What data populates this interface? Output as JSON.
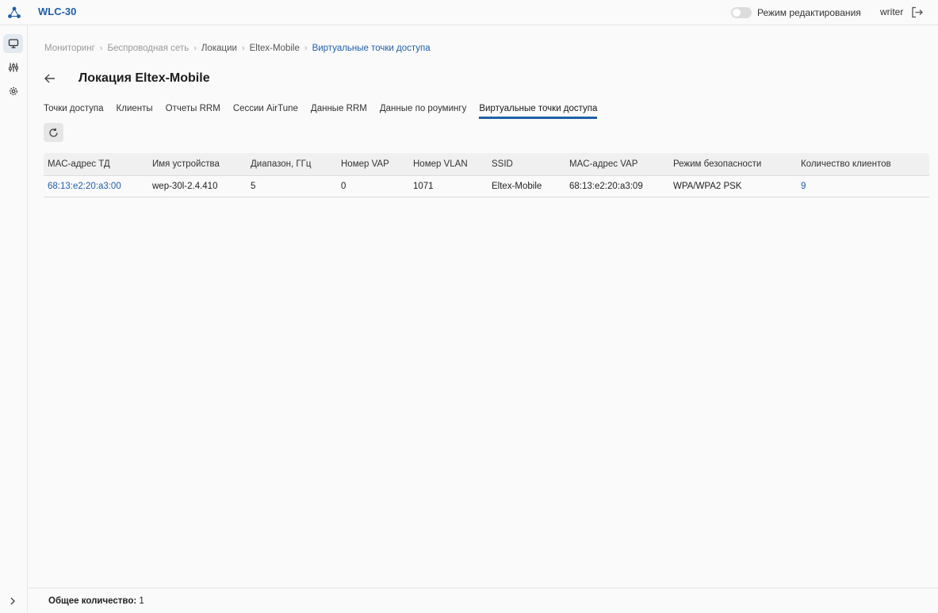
{
  "header": {
    "app_title": "WLC-30",
    "edit_mode_label": "Режим редактирования",
    "edit_mode_on": false,
    "user": "writer"
  },
  "sidebar": {
    "items": [
      {
        "icon": "monitor-icon",
        "active": true
      },
      {
        "icon": "sliders-icon",
        "active": false
      },
      {
        "icon": "gear-icon",
        "active": false
      }
    ]
  },
  "breadcrumb": [
    "Мониторинг",
    "Беспроводная сеть",
    "Локации",
    "Eltex-Mobile",
    "Виртуальные точки доступа"
  ],
  "page": {
    "title": "Локация Eltex-Mobile"
  },
  "tabs": [
    {
      "label": "Точки доступа"
    },
    {
      "label": "Клиенты"
    },
    {
      "label": "Отчеты RRM"
    },
    {
      "label": "Сессии AirTune"
    },
    {
      "label": "Данные RRM"
    },
    {
      "label": "Данные по роумингу"
    },
    {
      "label": "Виртуальные точки доступа",
      "active": true
    }
  ],
  "table": {
    "columns": [
      "MAC-адрес ТД",
      "Имя устройства",
      "Диапазон, ГГц",
      "Номер VAP",
      "Номер VLAN",
      "SSID",
      "MAC-адрес VAP",
      "Режим безопасности",
      "Количество клиентов"
    ],
    "rows": [
      [
        "68:13:e2:20:a3:00",
        "wep-30l-2.4.410",
        "5",
        "0",
        "1071",
        "Eltex-Mobile",
        "68:13:e2:20:a3:09",
        "WPA/WPA2 PSK",
        "9"
      ]
    ]
  },
  "footer": {
    "total_label": "Общее количество:",
    "total_value": "1"
  },
  "colors": {
    "accent": "#1f5fa8",
    "background": "#fafafa"
  }
}
